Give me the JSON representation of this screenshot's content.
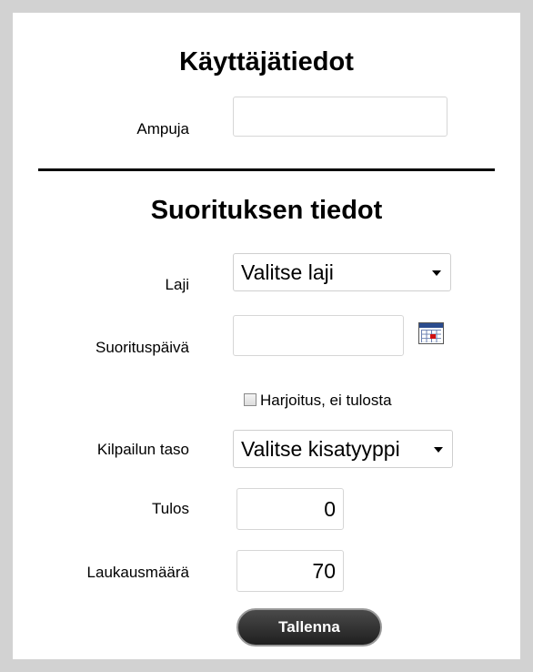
{
  "user_section": {
    "title": "Käyttäjätiedot",
    "shooter_label": "Ampuja",
    "shooter_value": ""
  },
  "performance_section": {
    "title": "Suorituksen tiedot",
    "event_label": "Laji",
    "event_selected": "Valitse laji",
    "date_label": "Suorituspäivä",
    "date_value": "",
    "practice_checkbox_label": "Harjoitus, ei tulosta",
    "practice_checked": false,
    "competition_level_label": "Kilpailun taso",
    "competition_level_selected": "Valitse kisatyyppi",
    "result_label": "Tulos",
    "result_value": "0",
    "shots_label": "Laukausmäärä",
    "shots_value": "70",
    "save_button": "Tallenna"
  },
  "icons": {
    "calendar": "calendar-icon",
    "dropdown": "chevron-down-icon"
  }
}
